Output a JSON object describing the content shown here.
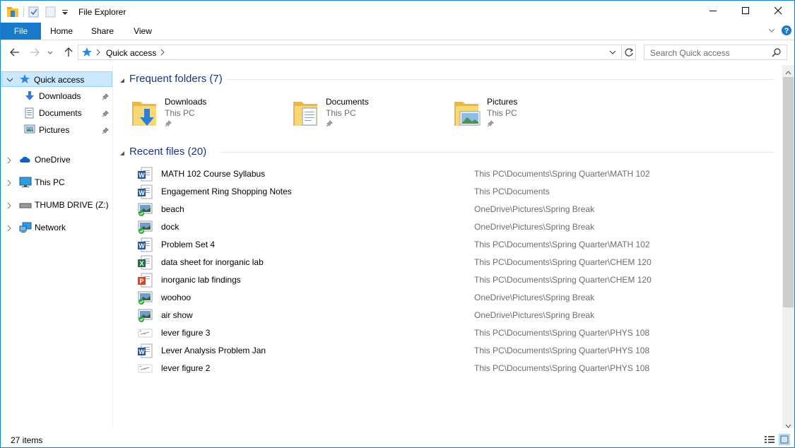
{
  "window": {
    "title": "File Explorer"
  },
  "ribbon": {
    "tabs": [
      {
        "label": "File"
      },
      {
        "label": "Home"
      },
      {
        "label": "Share"
      },
      {
        "label": "View"
      }
    ]
  },
  "address": {
    "location": "Quick access",
    "search_placeholder": "Search Quick access"
  },
  "sidebar": {
    "quick_access": "Quick access",
    "pinned": [
      {
        "label": "Downloads"
      },
      {
        "label": "Documents"
      },
      {
        "label": "Pictures"
      }
    ],
    "roots": [
      {
        "label": "OneDrive"
      },
      {
        "label": "This PC"
      },
      {
        "label": "THUMB DRIVE (Z:)"
      },
      {
        "label": "Network"
      }
    ]
  },
  "frequent": {
    "title": "Frequent folders (7)",
    "folders": [
      {
        "name": "Downloads",
        "location": "This PC"
      },
      {
        "name": "Documents",
        "location": "This PC"
      },
      {
        "name": "Pictures",
        "location": "This PC"
      }
    ]
  },
  "recent": {
    "title": "Recent files (20)",
    "files": [
      {
        "name": "MATH 102 Course Syllabus",
        "path": "This PC\\Documents\\Spring Quarter\\MATH 102",
        "icon": "word-doc-icon"
      },
      {
        "name": "Engagement Ring Shopping Notes",
        "path": "This PC\\Documents",
        "icon": "word-doc-icon"
      },
      {
        "name": "beach",
        "path": "OneDrive\\Pictures\\Spring Break",
        "icon": "image-synced-icon"
      },
      {
        "name": "dock",
        "path": "OneDrive\\Pictures\\Spring Break",
        "icon": "image-synced-icon"
      },
      {
        "name": "Problem Set 4",
        "path": "This PC\\Documents\\Spring Quarter\\MATH 102",
        "icon": "word-doc-icon"
      },
      {
        "name": "data sheet for inorganic lab",
        "path": "This PC\\Documents\\Spring Quarter\\CHEM 120",
        "icon": "excel-icon"
      },
      {
        "name": "inorganic lab findings",
        "path": "This PC\\Documents\\Spring Quarter\\CHEM 120",
        "icon": "powerpoint-icon"
      },
      {
        "name": "woohoo",
        "path": "OneDrive\\Pictures\\Spring Break",
        "icon": "image-synced-icon"
      },
      {
        "name": "air show",
        "path": "OneDrive\\Pictures\\Spring Break",
        "icon": "image-synced-icon"
      },
      {
        "name": "lever figure 3",
        "path": "This PC\\Documents\\Spring Quarter\\PHYS 108",
        "icon": "figure-icon"
      },
      {
        "name": "Lever Analysis Problem Jan",
        "path": "This PC\\Documents\\Spring Quarter\\PHYS 108",
        "icon": "word-doc-icon"
      },
      {
        "name": "lever figure 2",
        "path": "This PC\\Documents\\Spring Quarter\\PHYS 108",
        "icon": "figure-icon"
      }
    ]
  },
  "status": {
    "item_count": "27 items"
  },
  "colors": {
    "accent": "#1979ca",
    "group_title": "#1e3287",
    "selection": "#cce8ff"
  }
}
